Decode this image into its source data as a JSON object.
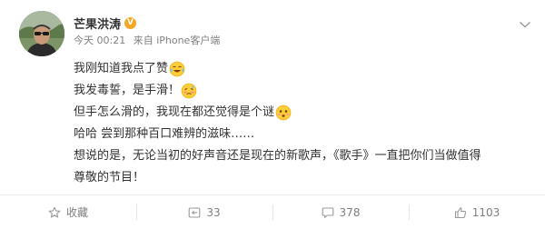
{
  "post": {
    "username": "芒果洪涛",
    "verified_badge": "V",
    "time": "今天 00:21",
    "source": "来自 iPhone客户端",
    "lines": [
      "我刚知道我点了赞",
      "我发毒誓，是手滑！",
      "但手怎么滑的，我现在都还觉得是个谜",
      "哈哈 尝到那种百口难辨的滋味……",
      "想说的是，无论当初的好声音还是现在的新歌声，《歌手》一直把你们当做值得",
      "尊敬的节目！"
    ],
    "icons": {
      "avatar": "user-avatar",
      "more": "chevron-down-icon",
      "emoji_1": "laugh-cry-emoji-icon",
      "emoji_2": "embarrassed-emoji-icon",
      "emoji_3": "puzzled-emoji-icon"
    }
  },
  "actions": {
    "favorite_label": "收藏",
    "repost_count": "33",
    "comment_count": "378",
    "like_count": "1103"
  },
  "colors": {
    "verified": "#f5a623",
    "text": "#333333",
    "meta": "#808080",
    "divider": "#eaeaea"
  }
}
